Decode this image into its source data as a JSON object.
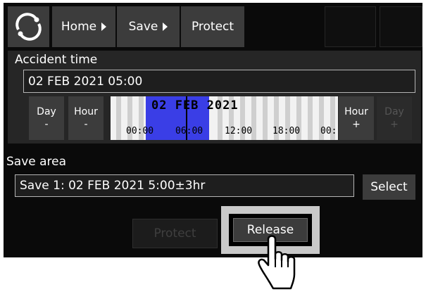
{
  "topbar": {
    "logo_icon": "circle-logo-icon",
    "crumbs": [
      "Home",
      "Save",
      "Protect"
    ]
  },
  "accident": {
    "label": "Accident time",
    "value": "02 FEB 2021 05:00",
    "day_minus": [
      "Day",
      "-"
    ],
    "hour_minus": [
      "Hour",
      "-"
    ],
    "hour_plus": [
      "Hour",
      "+"
    ],
    "day_plus": [
      "Day",
      "+"
    ],
    "timeline_date": "02 FEB 2021",
    "timeline_ticks": [
      "00:00",
      "06:00",
      "12:00",
      "18:00",
      "00:"
    ]
  },
  "save_area": {
    "label": "Save area",
    "value": "Save 1: 02 FEB 2021 5:00±3hr",
    "select_label": "Select"
  },
  "actions": {
    "protect_label": "Protect",
    "release_label": "Release"
  },
  "colors": {
    "highlight": "#3a3ee6",
    "button": "#3c3c3c",
    "background": "#0a0a0a"
  },
  "pointer": "hand-pointer-icon"
}
